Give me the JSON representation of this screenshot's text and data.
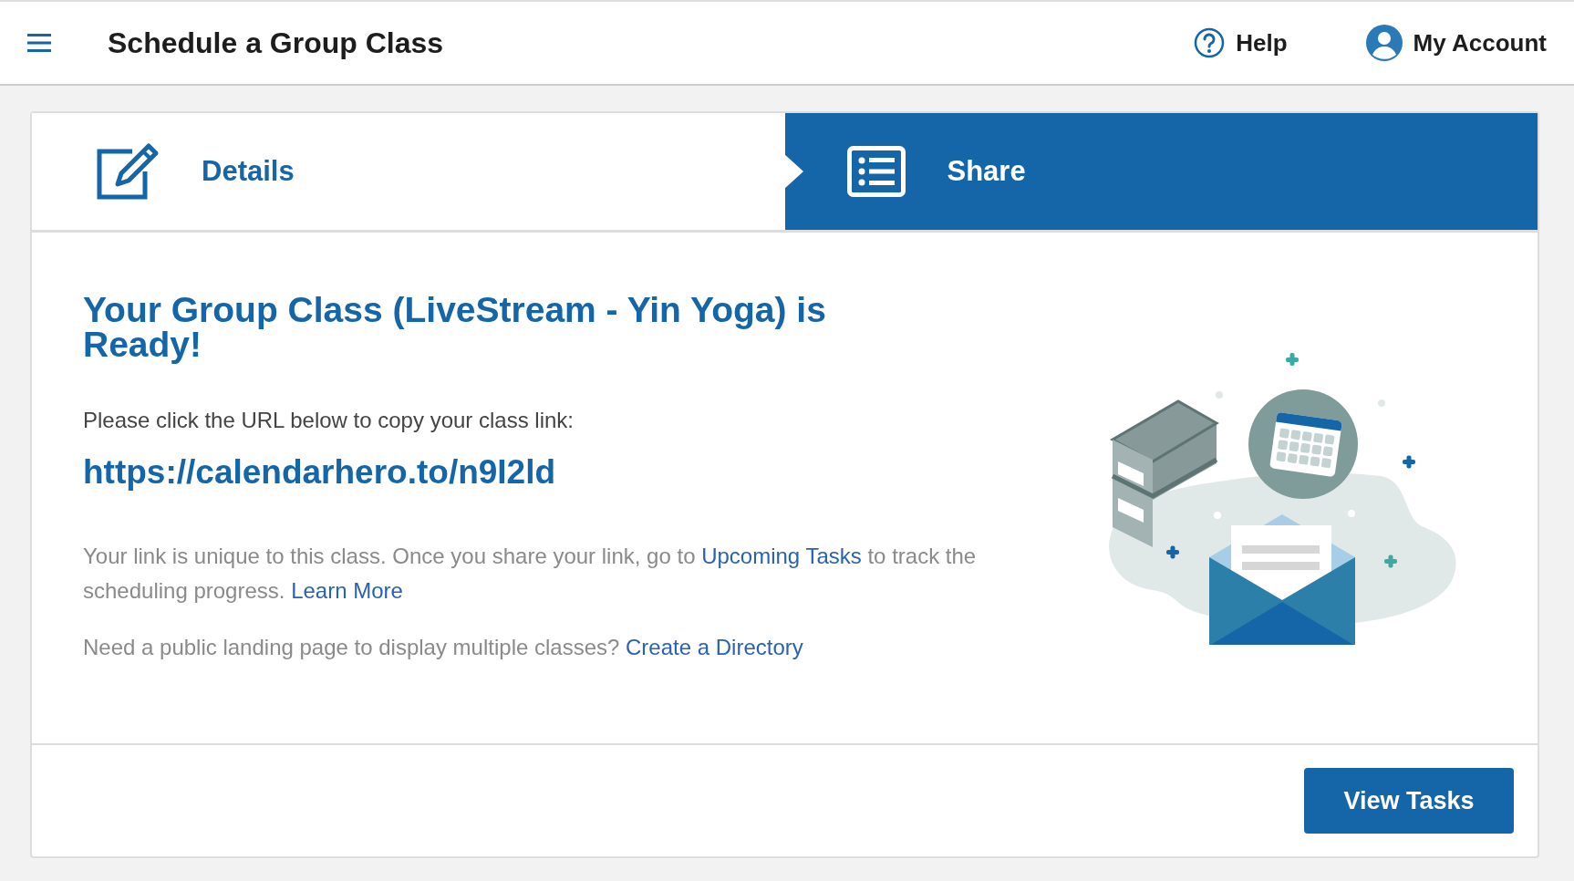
{
  "header": {
    "title": "Schedule a Group Class",
    "links": [
      {
        "label": "Help",
        "kind": "help"
      },
      {
        "label": "My Account",
        "kind": "account"
      }
    ]
  },
  "steps": [
    {
      "label": "Details",
      "kind": "edit",
      "selected": false
    },
    {
      "label": "Share",
      "kind": "list",
      "selected": true
    }
  ],
  "content": {
    "heading": "Your Group Class (LiveStream - Yin Yoga) is Ready!",
    "instruction": "Please click the URL below to copy your class link:",
    "url": "https://calendarhero.to/n9I2ld",
    "notes": [
      [
        {
          "text": "Your link is unique to this class. Once you share your link, go to ",
          "link": false
        },
        {
          "text": "Upcoming Tasks",
          "link": true
        },
        {
          "text": " to track the scheduling progress. ",
          "link": false
        },
        {
          "text": "Learn More",
          "link": true
        }
      ],
      [
        {
          "text": "Need a public landing page to display multiple classes? ",
          "link": false
        },
        {
          "text": "Create a Directory",
          "link": true
        }
      ]
    ]
  },
  "footer": {
    "button": "View Tasks"
  }
}
